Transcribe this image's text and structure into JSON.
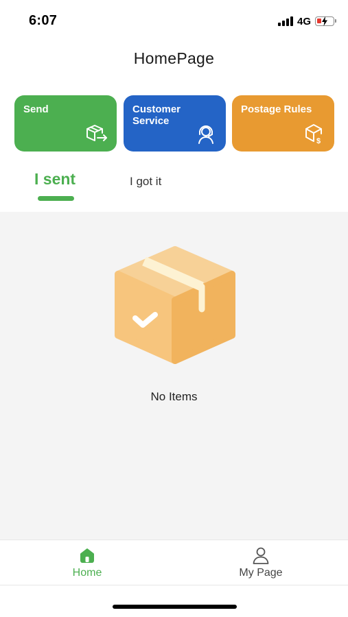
{
  "status_bar": {
    "time": "6:07",
    "network": "4G",
    "battery_level": 0.25
  },
  "header": {
    "title": "HomePage"
  },
  "actions": [
    {
      "label": "Send",
      "icon": "box-send-icon",
      "color": "#4caf50"
    },
    {
      "label": "Customer Service",
      "icon": "headset-agent-icon",
      "color": "#2464c6"
    },
    {
      "label": "Postage Rules",
      "icon": "box-dollar-icon",
      "color": "#e89a31"
    }
  ],
  "tabs": [
    {
      "label": "I sent",
      "active": true
    },
    {
      "label": "I got it",
      "active": false
    }
  ],
  "content": {
    "empty_icon": "parcel-box-icon",
    "empty_text": "No Items"
  },
  "bottom_nav": [
    {
      "label": "Home",
      "icon": "home-icon",
      "active": true
    },
    {
      "label": "My Page",
      "icon": "user-icon",
      "active": false
    }
  ],
  "colors": {
    "accent": "#4caf50",
    "content_bg": "#f4f4f4"
  }
}
